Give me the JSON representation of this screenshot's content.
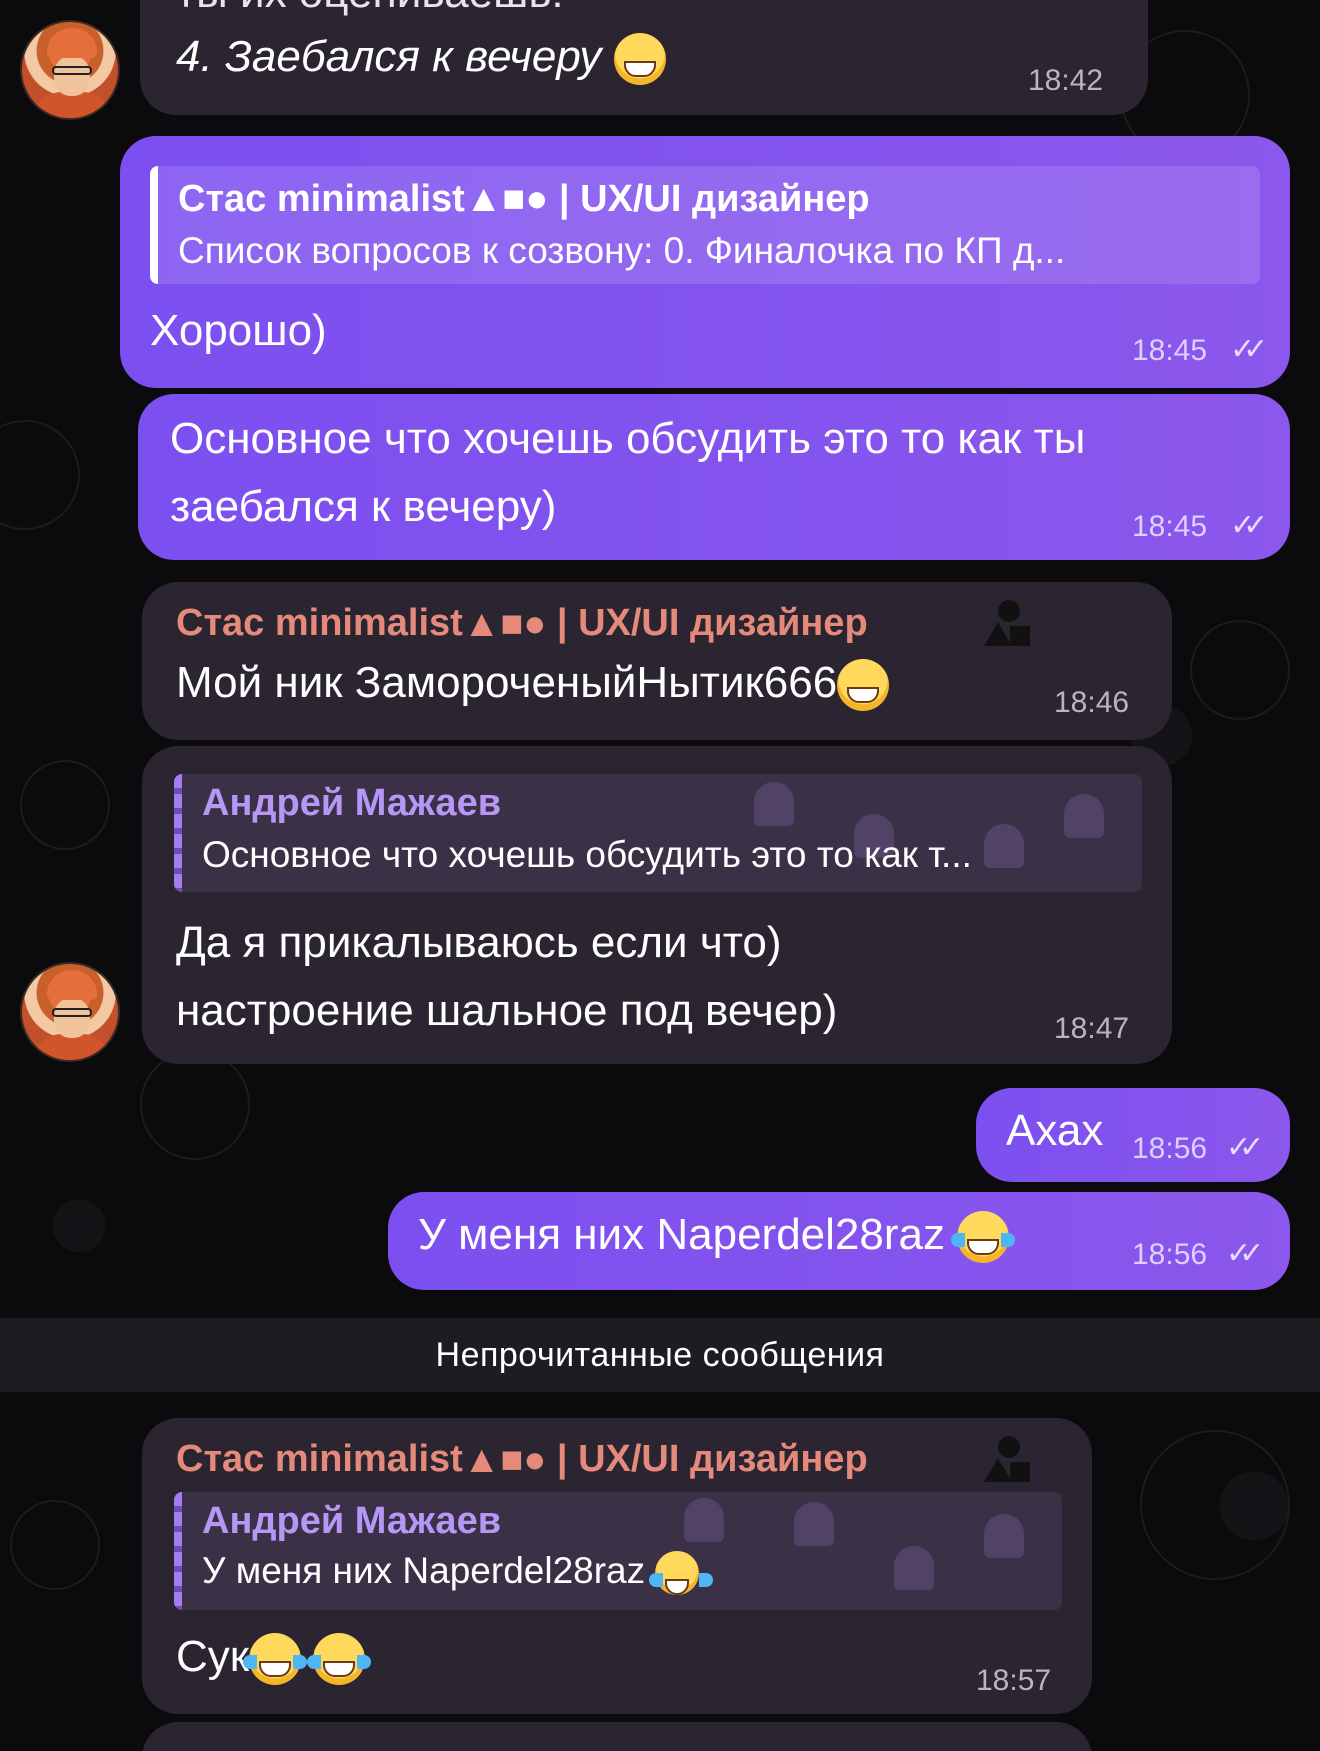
{
  "messages": {
    "m1": {
      "line_top": "ты их оцениваешь:",
      "text": "4. Заебался к вечеру",
      "time": "18:42"
    },
    "m2": {
      "quote_name": "Стас minimalist▲■● | UX/UI дизайнер",
      "quote_text": "Список вопросов к созвону: 0. Финалочка по КП д...",
      "text": "Хорошо)",
      "time": "18:45"
    },
    "m3": {
      "line1": "Основное что хочешь обсудить это то как ты",
      "line2": "заебался к вечеру)",
      "time": "18:45"
    },
    "m4": {
      "sender": "Стас minimalist",
      "sender_suffix": " | UX/UI дизайнер",
      "text": "Мой ник ЗамороченыйНытик666",
      "time": "18:46"
    },
    "m5": {
      "quote_name": "Андрей Мажаев",
      "quote_text": "Основное что хочешь обсудить это то как т...",
      "line1": "Да я прикалываюсь если что)",
      "line2": "настроение шальное под вечер)",
      "time": "18:47"
    },
    "m6": {
      "text": "Ахах",
      "time": "18:56"
    },
    "m7": {
      "text": "У меня них Naperdel28raz",
      "time": "18:56"
    },
    "m8": {
      "sender": "Стас minimalist",
      "sender_suffix": " | UX/UI дизайнер",
      "quote_name": "Андрей Мажаев",
      "quote_text": "У меня них Naperdel28raz",
      "text": "Сук",
      "time": "18:57"
    }
  },
  "unread_divider": "Непрочитанные сообщения",
  "icons": {
    "read": "double-check-icon",
    "emoji_grin": "grinning-emoji-icon",
    "emoji_cry": "tears-of-joy-emoji-icon",
    "sender_badge": "shapes-badge-icon"
  },
  "colors": {
    "outgoing_bubble": "#7c4ff0",
    "incoming_bubble": "#2a2530",
    "sender_name": "#e58a7b",
    "quote_name": "#b797f5",
    "background": "#0b0a0d"
  }
}
